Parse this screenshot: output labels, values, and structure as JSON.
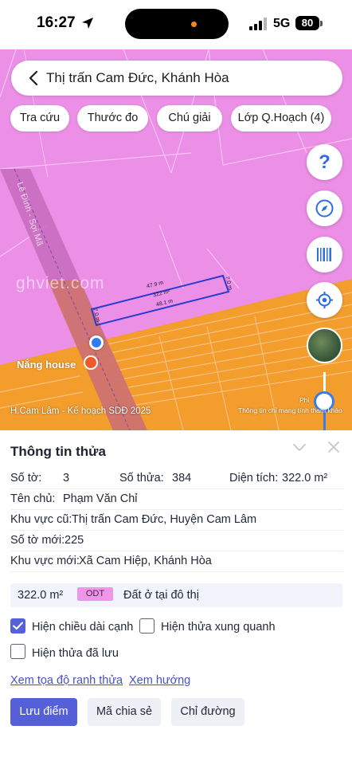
{
  "status_bar": {
    "time": "16:27",
    "network": "5G",
    "battery": "80"
  },
  "map": {
    "search": {
      "text": "Thị trấn Cam Đức, Khánh Hòa"
    },
    "chips": [
      "Tra cứu",
      "Thước đo",
      "Chú giải",
      "Lớp Q.Hoạch (4)"
    ],
    "fab_icons": [
      "help-icon",
      "compass-icon",
      "barcode-icon",
      "locate-icon"
    ],
    "watermark": "ghviet.com",
    "poi": "Nắng house",
    "road_name": "Lê Đình - Sợi Mã",
    "parcel": {
      "area": "322 m²",
      "top_edge": "47.9 m",
      "bottom_edge": "48.1 m",
      "left_edge": "7.0 m",
      "right_edge": "7.0 m"
    },
    "caption": "H.Cam Lâm - Kế hoạch SDĐ 2025",
    "disclaimer": "Thông tin chỉ mang tính tham khảo",
    "phi_label": "Phi",
    "colors": {
      "residential": "#ec8fe6",
      "planned": "#f39d2d",
      "accent": "#3a7bea"
    }
  },
  "panel": {
    "title": "Thông tin thửa",
    "so_to_label": "Số tờ:",
    "so_to_value": "3",
    "so_thua_label": "Số thửa:",
    "so_thua_value": "384",
    "dien_tich_label": "Diện tích:",
    "dien_tich_value": "322.0 m²",
    "ten_chu_label": "Tên chủ:",
    "ten_chu_value": "Phạm Văn Chỉ",
    "khu_vuc_cu_label": "Khu vực cũ:",
    "khu_vuc_cu_value": "Thị trấn Cam Đức, Huyện Cam Lâm",
    "so_to_moi_label": "Số tờ mới:",
    "so_to_moi_value": "225",
    "khu_vuc_moi_label": "Khu vực mới:",
    "khu_vuc_moi_value": "Xã Cam Hiệp, Khánh Hòa",
    "land_use": {
      "area": "322.0 m²",
      "code": "ODT",
      "description": "Đất ở tại đô thị"
    },
    "options": [
      {
        "label": "Hiện chiều dài cạnh",
        "checked": true
      },
      {
        "label": "Hiện thửa xung quanh",
        "checked": false
      },
      {
        "label": "Hiện thửa đã lưu",
        "checked": false
      }
    ],
    "links": [
      "Xem tọa độ ranh thửa",
      "Xem hướng"
    ],
    "buttons": [
      "Lưu điểm",
      "Mã chia sẻ",
      "Chỉ đường"
    ]
  }
}
